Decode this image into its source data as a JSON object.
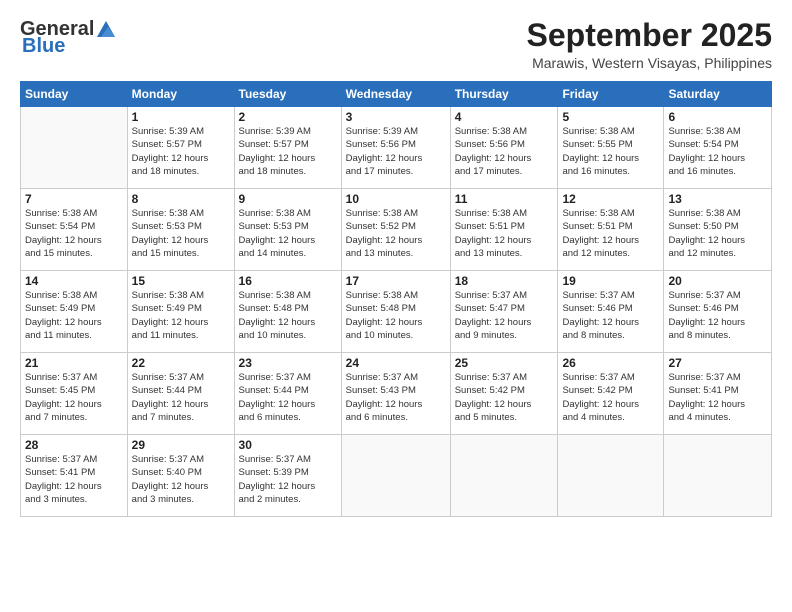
{
  "header": {
    "logo_general": "General",
    "logo_blue": "Blue",
    "month": "September 2025",
    "location": "Marawis, Western Visayas, Philippines"
  },
  "days_of_week": [
    "Sunday",
    "Monday",
    "Tuesday",
    "Wednesday",
    "Thursday",
    "Friday",
    "Saturday"
  ],
  "weeks": [
    [
      {
        "day": "",
        "info": ""
      },
      {
        "day": "1",
        "info": "Sunrise: 5:39 AM\nSunset: 5:57 PM\nDaylight: 12 hours\nand 18 minutes."
      },
      {
        "day": "2",
        "info": "Sunrise: 5:39 AM\nSunset: 5:57 PM\nDaylight: 12 hours\nand 18 minutes."
      },
      {
        "day": "3",
        "info": "Sunrise: 5:39 AM\nSunset: 5:56 PM\nDaylight: 12 hours\nand 17 minutes."
      },
      {
        "day": "4",
        "info": "Sunrise: 5:38 AM\nSunset: 5:56 PM\nDaylight: 12 hours\nand 17 minutes."
      },
      {
        "day": "5",
        "info": "Sunrise: 5:38 AM\nSunset: 5:55 PM\nDaylight: 12 hours\nand 16 minutes."
      },
      {
        "day": "6",
        "info": "Sunrise: 5:38 AM\nSunset: 5:54 PM\nDaylight: 12 hours\nand 16 minutes."
      }
    ],
    [
      {
        "day": "7",
        "info": "Sunrise: 5:38 AM\nSunset: 5:54 PM\nDaylight: 12 hours\nand 15 minutes."
      },
      {
        "day": "8",
        "info": "Sunrise: 5:38 AM\nSunset: 5:53 PM\nDaylight: 12 hours\nand 15 minutes."
      },
      {
        "day": "9",
        "info": "Sunrise: 5:38 AM\nSunset: 5:53 PM\nDaylight: 12 hours\nand 14 minutes."
      },
      {
        "day": "10",
        "info": "Sunrise: 5:38 AM\nSunset: 5:52 PM\nDaylight: 12 hours\nand 13 minutes."
      },
      {
        "day": "11",
        "info": "Sunrise: 5:38 AM\nSunset: 5:51 PM\nDaylight: 12 hours\nand 13 minutes."
      },
      {
        "day": "12",
        "info": "Sunrise: 5:38 AM\nSunset: 5:51 PM\nDaylight: 12 hours\nand 12 minutes."
      },
      {
        "day": "13",
        "info": "Sunrise: 5:38 AM\nSunset: 5:50 PM\nDaylight: 12 hours\nand 12 minutes."
      }
    ],
    [
      {
        "day": "14",
        "info": "Sunrise: 5:38 AM\nSunset: 5:49 PM\nDaylight: 12 hours\nand 11 minutes."
      },
      {
        "day": "15",
        "info": "Sunrise: 5:38 AM\nSunset: 5:49 PM\nDaylight: 12 hours\nand 11 minutes."
      },
      {
        "day": "16",
        "info": "Sunrise: 5:38 AM\nSunset: 5:48 PM\nDaylight: 12 hours\nand 10 minutes."
      },
      {
        "day": "17",
        "info": "Sunrise: 5:38 AM\nSunset: 5:48 PM\nDaylight: 12 hours\nand 10 minutes."
      },
      {
        "day": "18",
        "info": "Sunrise: 5:37 AM\nSunset: 5:47 PM\nDaylight: 12 hours\nand 9 minutes."
      },
      {
        "day": "19",
        "info": "Sunrise: 5:37 AM\nSunset: 5:46 PM\nDaylight: 12 hours\nand 8 minutes."
      },
      {
        "day": "20",
        "info": "Sunrise: 5:37 AM\nSunset: 5:46 PM\nDaylight: 12 hours\nand 8 minutes."
      }
    ],
    [
      {
        "day": "21",
        "info": "Sunrise: 5:37 AM\nSunset: 5:45 PM\nDaylight: 12 hours\nand 7 minutes."
      },
      {
        "day": "22",
        "info": "Sunrise: 5:37 AM\nSunset: 5:44 PM\nDaylight: 12 hours\nand 7 minutes."
      },
      {
        "day": "23",
        "info": "Sunrise: 5:37 AM\nSunset: 5:44 PM\nDaylight: 12 hours\nand 6 minutes."
      },
      {
        "day": "24",
        "info": "Sunrise: 5:37 AM\nSunset: 5:43 PM\nDaylight: 12 hours\nand 6 minutes."
      },
      {
        "day": "25",
        "info": "Sunrise: 5:37 AM\nSunset: 5:42 PM\nDaylight: 12 hours\nand 5 minutes."
      },
      {
        "day": "26",
        "info": "Sunrise: 5:37 AM\nSunset: 5:42 PM\nDaylight: 12 hours\nand 4 minutes."
      },
      {
        "day": "27",
        "info": "Sunrise: 5:37 AM\nSunset: 5:41 PM\nDaylight: 12 hours\nand 4 minutes."
      }
    ],
    [
      {
        "day": "28",
        "info": "Sunrise: 5:37 AM\nSunset: 5:41 PM\nDaylight: 12 hours\nand 3 minutes."
      },
      {
        "day": "29",
        "info": "Sunrise: 5:37 AM\nSunset: 5:40 PM\nDaylight: 12 hours\nand 3 minutes."
      },
      {
        "day": "30",
        "info": "Sunrise: 5:37 AM\nSunset: 5:39 PM\nDaylight: 12 hours\nand 2 minutes."
      },
      {
        "day": "",
        "info": ""
      },
      {
        "day": "",
        "info": ""
      },
      {
        "day": "",
        "info": ""
      },
      {
        "day": "",
        "info": ""
      }
    ]
  ]
}
